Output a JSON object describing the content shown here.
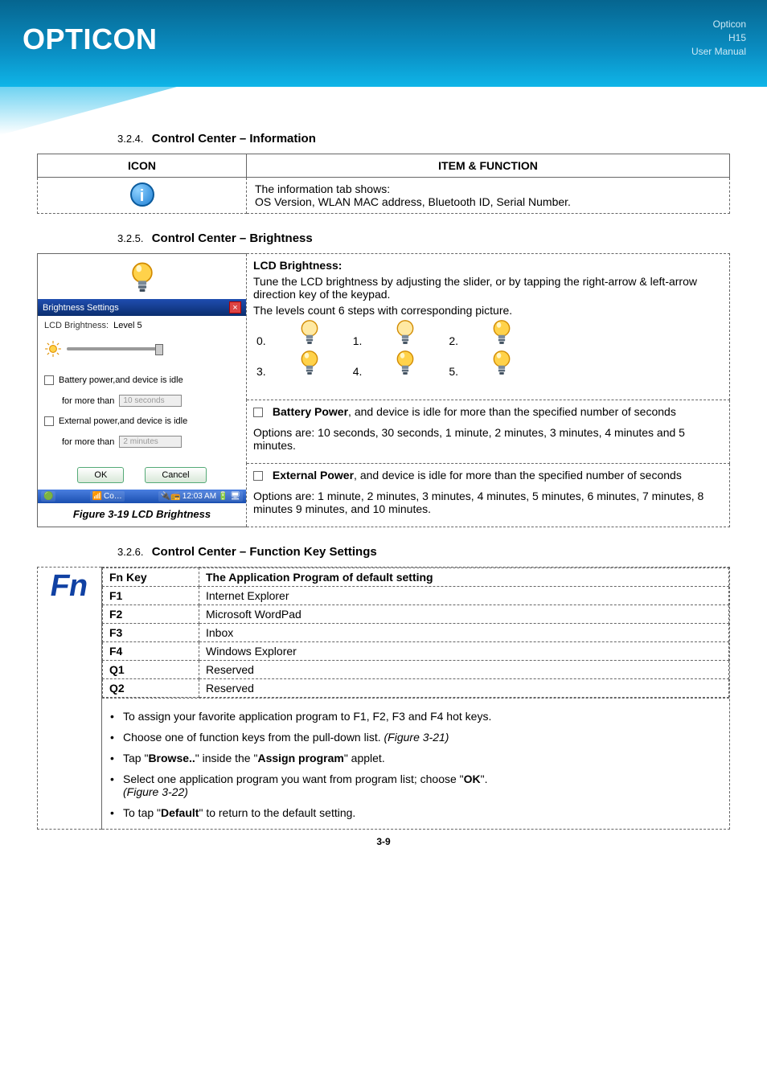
{
  "header": {
    "logo": "OPTICON",
    "meta_line1": "Opticon",
    "meta_line2": "H15",
    "meta_line3": "User Manual"
  },
  "sections": {
    "info_heading_num": "3.2.4.",
    "info_heading": "Control Center – Information",
    "brightness_heading_num": "3.2.5.",
    "brightness_heading": "Control Center – Brightness",
    "fnkey_heading_num": "3.2.6.",
    "fnkey_heading": "Control Center – Function Key Settings"
  },
  "info_table": {
    "col_icon": "ICON",
    "col_item": "ITEM & FUNCTION",
    "icon_glyph": "i",
    "desc_line1": "The information tab shows:",
    "desc_line2": "OS Version, WLAN MAC address, Bluetooth ID, Serial Number."
  },
  "brightness": {
    "lcd_title": "LCD Brightness:",
    "lcd_desc1": "Tune the LCD brightness by adjusting the slider, or by tapping the right-arrow & left-arrow direction key of the keypad.",
    "lcd_desc2": "The levels count 6 steps with corresponding picture.",
    "levels": [
      "0.",
      "1.",
      "2.",
      "3.",
      "4.",
      "5."
    ],
    "battery_title": "Battery Power",
    "battery_tail": ", and device is idle for more than the specified number of seconds",
    "battery_opts": "Options are: 10 seconds, 30 seconds, 1 minute, 2 minutes, 3 minutes, 4 minutes and 5 minutes.",
    "external_title": "External Power",
    "external_tail": ", and device is idle for more than the specified number of seconds",
    "external_opts": "Options are: 1 minute, 2 minutes, 3 minutes, 4 minutes, 5 minutes, 6 minutes, 7 minutes, 8 minutes 9 minutes, and 10 minutes.",
    "mock": {
      "title": "Brightness Settings",
      "close": "×",
      "lcd_label": "LCD Brightness:",
      "level_text": "Level 5",
      "row_battery": "Battery power,and device is idle",
      "row_battery2a": "for more than",
      "row_battery2b": "10 seconds",
      "row_external": "External power,and device is idle",
      "row_external2a": "for more than",
      "row_external2b": "2 minutes",
      "ok": "OK",
      "cancel": "Cancel",
      "taskbar_item": "Co…",
      "taskbar_time": "12:03 AM"
    },
    "caption": "Figure 3-19 LCD Brightness"
  },
  "fnkeys": {
    "header_key": "Fn Key",
    "header_app": "The Application Program of default setting",
    "rows": [
      {
        "key": "F1",
        "app": "Internet Explorer"
      },
      {
        "key": "F2",
        "app": "Microsoft WordPad"
      },
      {
        "key": "F3",
        "app": "Inbox"
      },
      {
        "key": "F4",
        "app": "Windows Explorer"
      },
      {
        "key": "Q1",
        "app": "Reserved"
      },
      {
        "key": "Q2",
        "app": "Reserved"
      }
    ],
    "bullet1": "To assign your favorite application program to F1, F2, F3 and F4 hot keys.",
    "bullet2_pre": "Choose one of function keys from the pull-down list. ",
    "bullet2_ref": "(Figure 3-21)",
    "bullet3_a": "Tap \"",
    "bullet3_b": "Browse..",
    "bullet3_c": "\" inside the \"",
    "bullet3_d": "Assign program",
    "bullet3_e": "\" applet.",
    "bullet4_pre": "Select one application program you want from program list; choose \"",
    "bullet4_ok": "OK",
    "bullet4_post": "\".",
    "bullet4_ref": "(Figure 3-22)",
    "bullet5_a": "To tap \"",
    "bullet5_b": "Default",
    "bullet5_c": "\" to return to the default setting.",
    "fn_icon_text": "Fn"
  },
  "page_number": "3-9"
}
